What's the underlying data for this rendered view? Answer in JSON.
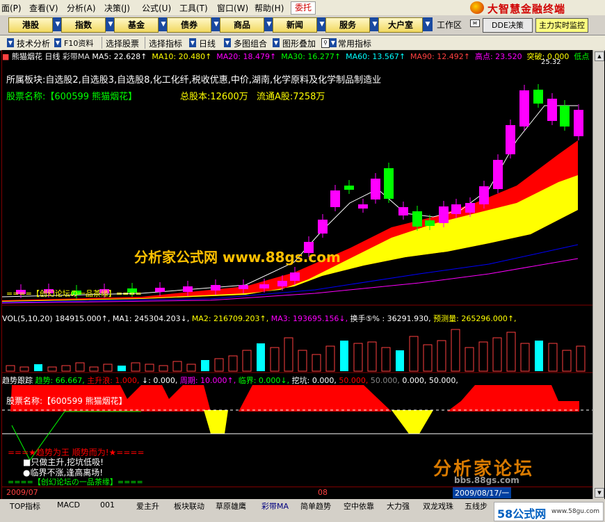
{
  "menu": [
    "面(P)",
    "查看(V)",
    "分析(A)",
    "决策(J)",
    "公式(U)",
    "工具(T)",
    "窗口(W)",
    "帮助(H)"
  ],
  "weituo": "委托",
  "brand": "大智慧金融终端",
  "nav_buttons": [
    "港股",
    "指数",
    "基金",
    "债券",
    "商品",
    "新闻",
    "服务",
    "大户室"
  ],
  "workarea": "工作区",
  "dde_btn": "DDE决策",
  "zhuli_btn": "主力实时监控",
  "toolbar": [
    "技术分析",
    "F10资料",
    "选择股票",
    "选择指标",
    "日线",
    "多图组合",
    "图形叠加",
    "常用指标"
  ],
  "main_header": {
    "stock": "熊猫烟花",
    "period": "日线",
    "indicator": "彩带MA",
    "ma5": "MA5: 22.628↑",
    "ma10": "MA10: 20.480↑",
    "ma20": "MA20: 18.479↑",
    "ma30": "MA30: 16.277↑",
    "ma60": "MA60: 13.567↑",
    "ma90": "MA90: 12.492↑",
    "high": "高点: 23.520",
    "break": "突破: 0.000",
    "low": "低点"
  },
  "price_peak": "25.32",
  "sector": "所属板块:自选股2,自选股3,自选股8,化工化纤,税收优惠,中价,湖南,化学原料及化学制品制造业",
  "stock_name_line": "股票名称:【600599 熊猫烟花】",
  "total_share": "总股本:12600万",
  "float_share": "流通A股:7258万",
  "watermark_main": "分析家公式网 www.88gs.com",
  "forum_line1": "====【创幻论坛の一品茶缘】====",
  "vol_header": {
    "label": "VOL(5,10,20)",
    "vol": "184915.000↑,",
    "ma1": "MA1: 245304.203↓,",
    "ma2": "MA2: 216709.203↑,",
    "ma3": "MA3: 193695.156↓,",
    "turnover": "换手⑤% : 36291.930,",
    "forecast": "预测量: 265296.000↑,"
  },
  "trend_header": {
    "label": "趋势跟踪",
    "trend": "趋势: 66.667,",
    "main_up": "主升浪: 1.000,",
    "arrow": "↓: 0.000,",
    "cycle": "周期: 10.000↑,",
    "critical": "临界: 0.000↓,",
    "pit": "挖坑: 0.000,",
    "v1": "50.000,",
    "v2": "50.000,",
    "v3": "0.000,",
    "v4": "50.000,"
  },
  "trend_stock_name": "股票名称:【600599 熊猫烟花】",
  "slogan": "===★趋势为王 顺势而为!★====",
  "tips": [
    "■只做主升,挖坑低吸!",
    "●临界不涨,逢高离场!"
  ],
  "forum_line2": "====【创幻论坛の一品茶缘】====",
  "forum_watermark": "分析家论坛",
  "forum_url": "bbs.88gs.com",
  "date_left": "2009/07",
  "date_mid": "08",
  "date_right": "2009/08/17/一",
  "bottom_tabs": [
    "TOP指标",
    "MACD",
    "001",
    "爱主升",
    "板块联动",
    "草原雄鹰",
    "彩带MA",
    "简单趋势",
    "空中依靠",
    "大力强",
    "双龙戏珠",
    "五线步"
  ],
  "site_logo": "58公式网",
  "site_url": "www.58gu.com",
  "colors": {
    "red": "#ff0000",
    "yellow": "#ffff00",
    "magenta": "#ff00ff",
    "cyan": "#00ffff",
    "green": "#00ff00"
  }
}
